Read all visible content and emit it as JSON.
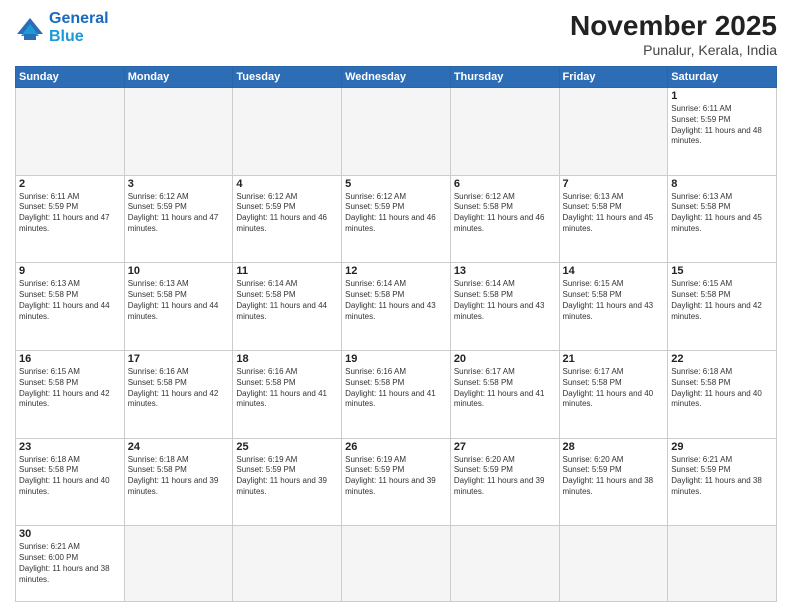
{
  "logo": {
    "line1": "General",
    "line2": "Blue"
  },
  "header": {
    "title": "November 2025",
    "location": "Punalur, Kerala, India"
  },
  "days_of_week": [
    "Sunday",
    "Monday",
    "Tuesday",
    "Wednesday",
    "Thursday",
    "Friday",
    "Saturday"
  ],
  "weeks": [
    [
      {
        "day": "",
        "sunrise": "",
        "sunset": "",
        "daylight": ""
      },
      {
        "day": "",
        "sunrise": "",
        "sunset": "",
        "daylight": ""
      },
      {
        "day": "",
        "sunrise": "",
        "sunset": "",
        "daylight": ""
      },
      {
        "day": "",
        "sunrise": "",
        "sunset": "",
        "daylight": ""
      },
      {
        "day": "",
        "sunrise": "",
        "sunset": "",
        "daylight": ""
      },
      {
        "day": "",
        "sunrise": "",
        "sunset": "",
        "daylight": ""
      },
      {
        "day": "1",
        "sunrise": "Sunrise: 6:11 AM",
        "sunset": "Sunset: 5:59 PM",
        "daylight": "Daylight: 11 hours and 48 minutes."
      }
    ],
    [
      {
        "day": "2",
        "sunrise": "Sunrise: 6:11 AM",
        "sunset": "Sunset: 5:59 PM",
        "daylight": "Daylight: 11 hours and 47 minutes."
      },
      {
        "day": "3",
        "sunrise": "Sunrise: 6:12 AM",
        "sunset": "Sunset: 5:59 PM",
        "daylight": "Daylight: 11 hours and 47 minutes."
      },
      {
        "day": "4",
        "sunrise": "Sunrise: 6:12 AM",
        "sunset": "Sunset: 5:59 PM",
        "daylight": "Daylight: 11 hours and 46 minutes."
      },
      {
        "day": "5",
        "sunrise": "Sunrise: 6:12 AM",
        "sunset": "Sunset: 5:59 PM",
        "daylight": "Daylight: 11 hours and 46 minutes."
      },
      {
        "day": "6",
        "sunrise": "Sunrise: 6:12 AM",
        "sunset": "Sunset: 5:58 PM",
        "daylight": "Daylight: 11 hours and 46 minutes."
      },
      {
        "day": "7",
        "sunrise": "Sunrise: 6:13 AM",
        "sunset": "Sunset: 5:58 PM",
        "daylight": "Daylight: 11 hours and 45 minutes."
      },
      {
        "day": "8",
        "sunrise": "Sunrise: 6:13 AM",
        "sunset": "Sunset: 5:58 PM",
        "daylight": "Daylight: 11 hours and 45 minutes."
      }
    ],
    [
      {
        "day": "9",
        "sunrise": "Sunrise: 6:13 AM",
        "sunset": "Sunset: 5:58 PM",
        "daylight": "Daylight: 11 hours and 44 minutes."
      },
      {
        "day": "10",
        "sunrise": "Sunrise: 6:13 AM",
        "sunset": "Sunset: 5:58 PM",
        "daylight": "Daylight: 11 hours and 44 minutes."
      },
      {
        "day": "11",
        "sunrise": "Sunrise: 6:14 AM",
        "sunset": "Sunset: 5:58 PM",
        "daylight": "Daylight: 11 hours and 44 minutes."
      },
      {
        "day": "12",
        "sunrise": "Sunrise: 6:14 AM",
        "sunset": "Sunset: 5:58 PM",
        "daylight": "Daylight: 11 hours and 43 minutes."
      },
      {
        "day": "13",
        "sunrise": "Sunrise: 6:14 AM",
        "sunset": "Sunset: 5:58 PM",
        "daylight": "Daylight: 11 hours and 43 minutes."
      },
      {
        "day": "14",
        "sunrise": "Sunrise: 6:15 AM",
        "sunset": "Sunset: 5:58 PM",
        "daylight": "Daylight: 11 hours and 43 minutes."
      },
      {
        "day": "15",
        "sunrise": "Sunrise: 6:15 AM",
        "sunset": "Sunset: 5:58 PM",
        "daylight": "Daylight: 11 hours and 42 minutes."
      }
    ],
    [
      {
        "day": "16",
        "sunrise": "Sunrise: 6:15 AM",
        "sunset": "Sunset: 5:58 PM",
        "daylight": "Daylight: 11 hours and 42 minutes."
      },
      {
        "day": "17",
        "sunrise": "Sunrise: 6:16 AM",
        "sunset": "Sunset: 5:58 PM",
        "daylight": "Daylight: 11 hours and 42 minutes."
      },
      {
        "day": "18",
        "sunrise": "Sunrise: 6:16 AM",
        "sunset": "Sunset: 5:58 PM",
        "daylight": "Daylight: 11 hours and 41 minutes."
      },
      {
        "day": "19",
        "sunrise": "Sunrise: 6:16 AM",
        "sunset": "Sunset: 5:58 PM",
        "daylight": "Daylight: 11 hours and 41 minutes."
      },
      {
        "day": "20",
        "sunrise": "Sunrise: 6:17 AM",
        "sunset": "Sunset: 5:58 PM",
        "daylight": "Daylight: 11 hours and 41 minutes."
      },
      {
        "day": "21",
        "sunrise": "Sunrise: 6:17 AM",
        "sunset": "Sunset: 5:58 PM",
        "daylight": "Daylight: 11 hours and 40 minutes."
      },
      {
        "day": "22",
        "sunrise": "Sunrise: 6:18 AM",
        "sunset": "Sunset: 5:58 PM",
        "daylight": "Daylight: 11 hours and 40 minutes."
      }
    ],
    [
      {
        "day": "23",
        "sunrise": "Sunrise: 6:18 AM",
        "sunset": "Sunset: 5:58 PM",
        "daylight": "Daylight: 11 hours and 40 minutes."
      },
      {
        "day": "24",
        "sunrise": "Sunrise: 6:18 AM",
        "sunset": "Sunset: 5:58 PM",
        "daylight": "Daylight: 11 hours and 39 minutes."
      },
      {
        "day": "25",
        "sunrise": "Sunrise: 6:19 AM",
        "sunset": "Sunset: 5:59 PM",
        "daylight": "Daylight: 11 hours and 39 minutes."
      },
      {
        "day": "26",
        "sunrise": "Sunrise: 6:19 AM",
        "sunset": "Sunset: 5:59 PM",
        "daylight": "Daylight: 11 hours and 39 minutes."
      },
      {
        "day": "27",
        "sunrise": "Sunrise: 6:20 AM",
        "sunset": "Sunset: 5:59 PM",
        "daylight": "Daylight: 11 hours and 39 minutes."
      },
      {
        "day": "28",
        "sunrise": "Sunrise: 6:20 AM",
        "sunset": "Sunset: 5:59 PM",
        "daylight": "Daylight: 11 hours and 38 minutes."
      },
      {
        "day": "29",
        "sunrise": "Sunrise: 6:21 AM",
        "sunset": "Sunset: 5:59 PM",
        "daylight": "Daylight: 11 hours and 38 minutes."
      }
    ],
    [
      {
        "day": "30",
        "sunrise": "Sunrise: 6:21 AM",
        "sunset": "Sunset: 6:00 PM",
        "daylight": "Daylight: 11 hours and 38 minutes."
      },
      {
        "day": "",
        "sunrise": "",
        "sunset": "",
        "daylight": ""
      },
      {
        "day": "",
        "sunrise": "",
        "sunset": "",
        "daylight": ""
      },
      {
        "day": "",
        "sunrise": "",
        "sunset": "",
        "daylight": ""
      },
      {
        "day": "",
        "sunrise": "",
        "sunset": "",
        "daylight": ""
      },
      {
        "day": "",
        "sunrise": "",
        "sunset": "",
        "daylight": ""
      },
      {
        "day": "",
        "sunrise": "",
        "sunset": "",
        "daylight": ""
      }
    ]
  ]
}
